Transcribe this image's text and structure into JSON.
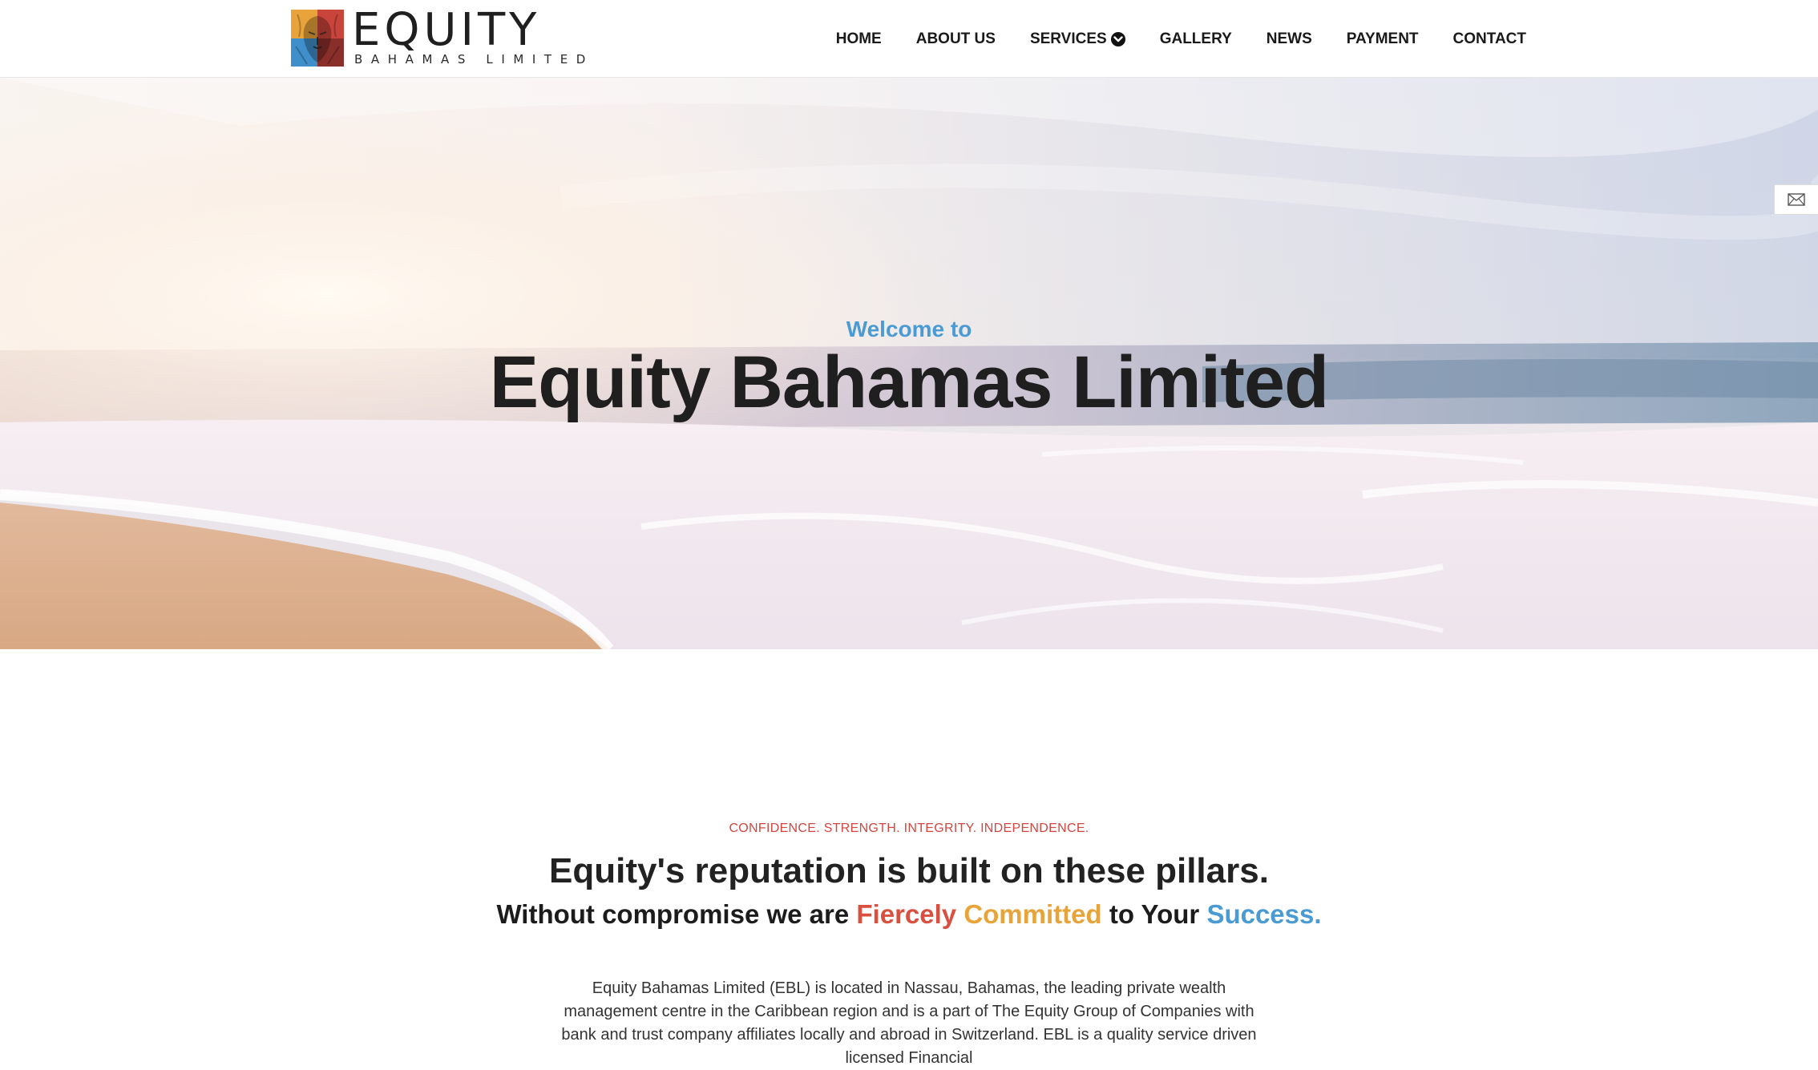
{
  "header": {
    "logo": {
      "word": "EQUITY",
      "sub": "BAHAMAS LIMITED"
    },
    "nav": [
      {
        "label": "HOME"
      },
      {
        "label": "ABOUT US"
      },
      {
        "label": "SERVICES"
      },
      {
        "label": "GALLERY"
      },
      {
        "label": "NEWS"
      },
      {
        "label": "PAYMENT"
      },
      {
        "label": "CONTACT"
      }
    ]
  },
  "hero": {
    "welcome": "Welcome to",
    "title": "Equity Bahamas Limited"
  },
  "pillars": {
    "eyebrow": "CONFIDENCE. STRENGTH. INTEGRITY. INDEPENDENCE.",
    "heading": "Equity's reputation is built on these pillars.",
    "sub_prefix": "Without compromise we are ",
    "word1": "Fiercely",
    "word2": "Committed",
    "sub_mid": " to Your ",
    "word3": "Success."
  },
  "intro": {
    "text": "Equity Bahamas Limited (EBL) is located in Nassau, Bahamas, the leading private wealth management centre in the Caribbean region and is a part of The Equity Group of Companies with bank and trust company affiliates locally and abroad in Switzerland. EBL is a quality service driven licensed Financial"
  },
  "colors": {
    "accent_blue": "#4a9ad4",
    "accent_red": "#d9503f",
    "accent_orange": "#e7a43a"
  },
  "icons": {
    "nav_dropdown": "chevron-down-icon",
    "side_tab": "mail-icon"
  }
}
